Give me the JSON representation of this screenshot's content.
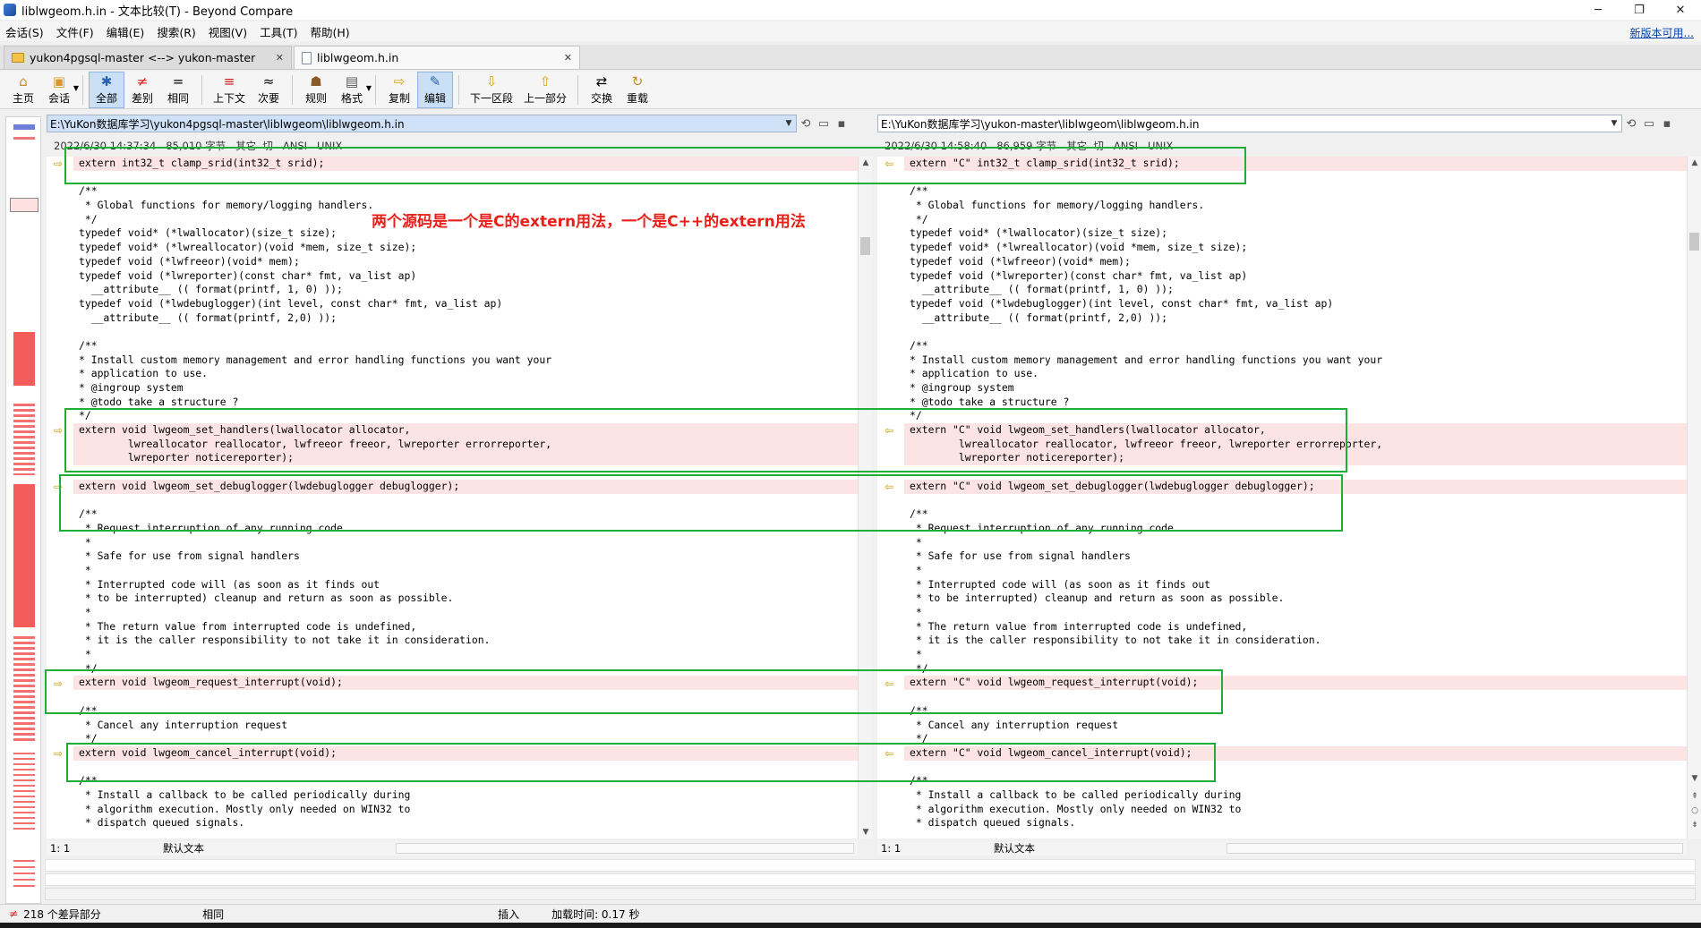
{
  "window": {
    "title": "liblwgeom.h.in - 文本比较(T) - Beyond Compare",
    "min": "─",
    "max": "❐",
    "close": "✕"
  },
  "menu": {
    "items": [
      "会话(S)",
      "文件(F)",
      "编辑(E)",
      "搜索(R)",
      "视图(V)",
      "工具(T)",
      "帮助(H)"
    ],
    "update": "新版本可用..."
  },
  "tabs": [
    {
      "label": "yukon4pgsql-master <--> yukon-master",
      "close": "✕"
    },
    {
      "label": "liblwgeom.h.in",
      "close": "✕"
    }
  ],
  "toolbar": {
    "home": "主页",
    "session": "会话",
    "all": "全部",
    "diffs": "差别",
    "same": "相同",
    "context": "上下文",
    "minor": "次要",
    "rules": "规则",
    "format": "格式",
    "copy": "复制",
    "edit": "编辑",
    "next": "下一区段",
    "prev": "上一部分",
    "swap": "交换",
    "reload": "重载"
  },
  "left": {
    "path": "E:\\YuKon数据库学习\\yukon4pgsql-master\\liblwgeom\\liblwgeom.h.in",
    "info": "2022/6/30 14:37:34   85,010 字节   其它  切   ANSI   UNIX",
    "pos": "1: 1",
    "encoding": "默认文本"
  },
  "right": {
    "path": "E:\\YuKon数据库学习\\yukon-master\\liblwgeom\\liblwgeom.h.in",
    "info": "2022/6/30 14:58:40   86,959 字节   其它  切   ANSI   UNIX",
    "pos": "1: 1",
    "encoding": "默认文本"
  },
  "lines_left": [
    "extern int32_t clamp_srid(int32_t srid);",
    "",
    "/**",
    " * Global functions for memory/logging handlers.",
    " */",
    "typedef void* (*lwallocator)(size_t size);",
    "typedef void* (*lwreallocator)(void *mem, size_t size);",
    "typedef void (*lwfreeor)(void* mem);",
    "typedef void (*lwreporter)(const char* fmt, va_list ap)",
    "  __attribute__ (( format(printf, 1, 0) ));",
    "typedef void (*lwdebuglogger)(int level, const char* fmt, va_list ap)",
    "  __attribute__ (( format(printf, 2,0) ));",
    "",
    "/**",
    "* Install custom memory management and error handling functions you want your",
    "* application to use.",
    "* @ingroup system",
    "* @todo take a structure ?",
    "*/",
    "extern void lwgeom_set_handlers(lwallocator allocator,",
    "        lwreallocator reallocator, lwfreeor freeor, lwreporter errorreporter,",
    "        lwreporter noticereporter);",
    "",
    "extern void lwgeom_set_debuglogger(lwdebuglogger debuglogger);",
    "",
    "/**",
    " * Request interruption of any running code",
    " *",
    " * Safe for use from signal handlers",
    " *",
    " * Interrupted code will (as soon as it finds out",
    " * to be interrupted) cleanup and return as soon as possible.",
    " *",
    " * The return value from interrupted code is undefined,",
    " * it is the caller responsibility to not take it in consideration.",
    " *",
    " */",
    "extern void lwgeom_request_interrupt(void);",
    "",
    "/**",
    " * Cancel any interruption request",
    " */",
    "extern void lwgeom_cancel_interrupt(void);",
    "",
    "/**",
    " * Install a callback to be called periodically during",
    " * algorithm execution. Mostly only needed on WIN32 to",
    " * dispatch queued signals."
  ],
  "lines_right": [
    "extern \"C\" int32_t clamp_srid(int32_t srid);",
    "",
    "/**",
    " * Global functions for memory/logging handlers.",
    " */",
    "typedef void* (*lwallocator)(size_t size);",
    "typedef void* (*lwreallocator)(void *mem, size_t size);",
    "typedef void (*lwfreeor)(void* mem);",
    "typedef void (*lwreporter)(const char* fmt, va_list ap)",
    "  __attribute__ (( format(printf, 1, 0) ));",
    "typedef void (*lwdebuglogger)(int level, const char* fmt, va_list ap)",
    "  __attribute__ (( format(printf, 2,0) ));",
    "",
    "/**",
    "* Install custom memory management and error handling functions you want your",
    "* application to use.",
    "* @ingroup system",
    "* @todo take a structure ?",
    "*/",
    "extern \"C\" void lwgeom_set_handlers(lwallocator allocator,",
    "        lwreallocator reallocator, lwfreeor freeor, lwreporter errorreporter,",
    "        lwreporter noticereporter);",
    "",
    "extern \"C\" void lwgeom_set_debuglogger(lwdebuglogger debuglogger);",
    "",
    "/**",
    " * Request interruption of any running code",
    " *",
    " * Safe for use from signal handlers",
    " *",
    " * Interrupted code will (as soon as it finds out",
    " * to be interrupted) cleanup and return as soon as possible.",
    " *",
    " * The return value from interrupted code is undefined,",
    " * it is the caller responsibility to not take it in consideration.",
    " *",
    " */",
    "extern \"C\" void lwgeom_request_interrupt(void);",
    "",
    "/**",
    " * Cancel any interruption request",
    " */",
    "extern \"C\" void lwgeom_cancel_interrupt(void);",
    "",
    "/**",
    " * Install a callback to be called periodically during",
    " * algorithm execution. Mostly only needed on WIN32 to",
    " * dispatch queued signals."
  ],
  "diff_lines": [
    0,
    19,
    20,
    21,
    23,
    37,
    42
  ],
  "line_compare": {
    "top": "/************************************************************************",
    "bottom": "/************************************************************************"
  },
  "annotation": "两个源码是一个是C的extern用法，一个是C++的extern用法",
  "status": {
    "diffs": "218 个差异部分",
    "same": "相同",
    "mode": "插入",
    "load_time": "加载时间:  0.17 秒"
  }
}
